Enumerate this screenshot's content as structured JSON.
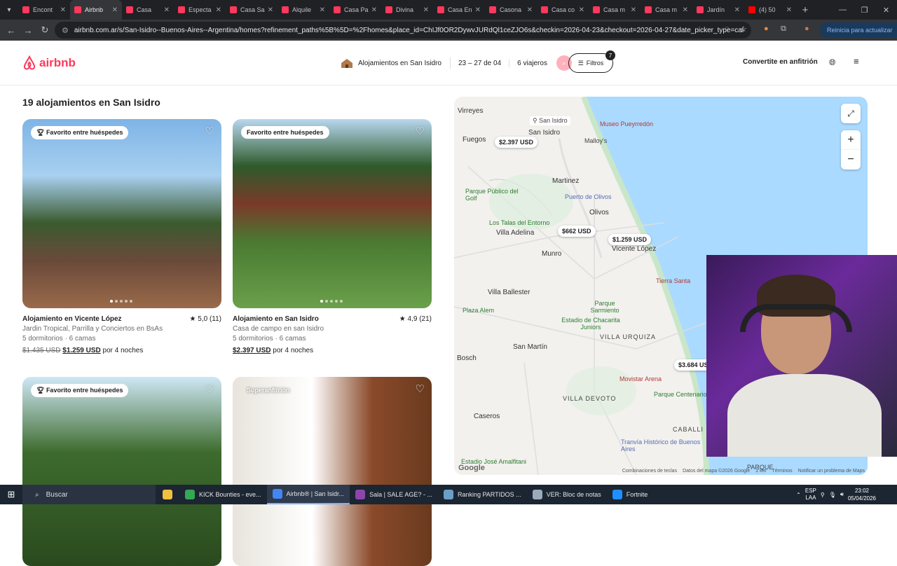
{
  "browser": {
    "tabs": [
      {
        "title": "Encont",
        "active": false
      },
      {
        "title": "Airbnb",
        "active": true
      },
      {
        "title": "Casa",
        "active": false
      },
      {
        "title": "Especta",
        "active": false
      },
      {
        "title": "Casa Sa",
        "active": false
      },
      {
        "title": "Alquile",
        "active": false
      },
      {
        "title": "Casa Pa",
        "active": false
      },
      {
        "title": "Divina",
        "active": false
      },
      {
        "title": "Casa En",
        "active": false
      },
      {
        "title": "Casona",
        "active": false
      },
      {
        "title": "Casa co",
        "active": false
      },
      {
        "title": "Casa m",
        "active": false
      },
      {
        "title": "Casa m",
        "active": false
      },
      {
        "title": "Jardín",
        "active": false
      },
      {
        "title": "(4) 50",
        "active": false
      }
    ],
    "url": "airbnb.com.ar/s/San-Isidro--Buenos-Aires--Argentina/homes?refinement_paths%5B%5D=%2Fhomes&place_id=ChIJf0OR2DywvJURdQl1ceZJO6s&checkin=2026-04-23&checkout=2026-04-27&date_picker_type=calendar&...",
    "update_label": "Reinicia para actualizar"
  },
  "header": {
    "logo_text": "airbnb",
    "search_location": "Alojamientos en San Isidro",
    "search_dates": "23 – 27 de 04",
    "search_guests": "6 viajeros",
    "filters_label": "Filtros",
    "filters_count": "7",
    "host_label": "Convertite en anfitrión"
  },
  "results": {
    "title": "19 alojamientos en San Isidro",
    "listings": [
      {
        "badge": "Favorito entre huéspedes",
        "title": "Alojamiento en Vicente López",
        "rating": "★ 5,0 (11)",
        "subtitle": "Jardin Tropical, Parrilla y Conciertos en BsAs",
        "rooms": "5 dormitorios · 6 camas",
        "old_price": "$1.435 USD",
        "price": "$1.259 USD",
        "price_suffix": "por 4 noches"
      },
      {
        "badge": "Favorito entre huéspedes",
        "title": "Alojamiento en San Isidro",
        "rating": "★ 4,9 (21)",
        "subtitle": "Casa de campo en san Isidro",
        "rooms": "5 dormitorios · 6 camas",
        "old_price": "",
        "price": "$2.397 USD",
        "price_suffix": "por 4 noches"
      },
      {
        "badge": "Favorito entre huéspedes"
      },
      {
        "badge": "Superanfitrión"
      }
    ]
  },
  "map": {
    "labels": {
      "virreyes": "Virreyes",
      "san_isidro_pin": "San Isidro",
      "san_isidro": "San Isidro",
      "fuegos": "Fuegos",
      "museo": "Museo Pueyrredón",
      "malloys": "Malloy's",
      "martinez": "Martinez",
      "puerto_olivos": "Puerto de Olivos",
      "olivos": "Olivos",
      "parque_golf": "Parque Público del Golf",
      "talas": "Los Talas del Entorno",
      "villa_adelina": "Villa Adelina",
      "vicente_lopez": "Vicente López",
      "munro": "Munro",
      "villa_ballester": "Villa Ballester",
      "plaza_alem": "Plaza Alem",
      "parque_sarmiento": "Parque Sarmiento",
      "estadio_chacarita": "Estadio de Chacarita Juniors",
      "villa_urquiza": "VILLA URQUIZA",
      "san_martin": "San Martín",
      "bosch": "Bosch",
      "villa_devoto": "VILLA DEVOTO",
      "caseros": "Caseros",
      "tierra_santa": "Tierra Santa",
      "movistar": "Movistar Arena",
      "parque_centenario": "Parque Centenario",
      "caballi": "CABALLI",
      "tranvia": "Tranvía Histórico de Buenos Aires",
      "jose_amenitati": "Estadio José Amalfitani",
      "parque": "PARQUE"
    },
    "prices": {
      "p1": "$2.397 USD",
      "p2": "$662 USD",
      "p3": "$1.259 USD",
      "p4": "$3.684 USD"
    },
    "google": "Google",
    "footer": [
      "Combinaciones de teclas",
      "Datos del mapa ©2026 Google",
      "2 km",
      "Términos",
      "Notificar un problema de Maps"
    ]
  },
  "taskbar": {
    "search": "Buscar",
    "apps": [
      {
        "label": "KICK Bounties - eve...",
        "color": "#34a853"
      },
      {
        "label": "Airbnb® | San Isidr...",
        "color": "#4285f4"
      },
      {
        "label": "Sala | SALE AGE? - ...",
        "color": "#8e44ad"
      },
      {
        "label": "Ranking PARTIDOS ...",
        "color": "#6aa0c8"
      },
      {
        "label": "VER: Bloc de notas",
        "color": "#9ab"
      },
      {
        "label": "Fortnite",
        "color": "#1e90ff"
      }
    ],
    "lang": "ESP\nLAA",
    "time": "23:02",
    "date": "05/04/2026"
  }
}
